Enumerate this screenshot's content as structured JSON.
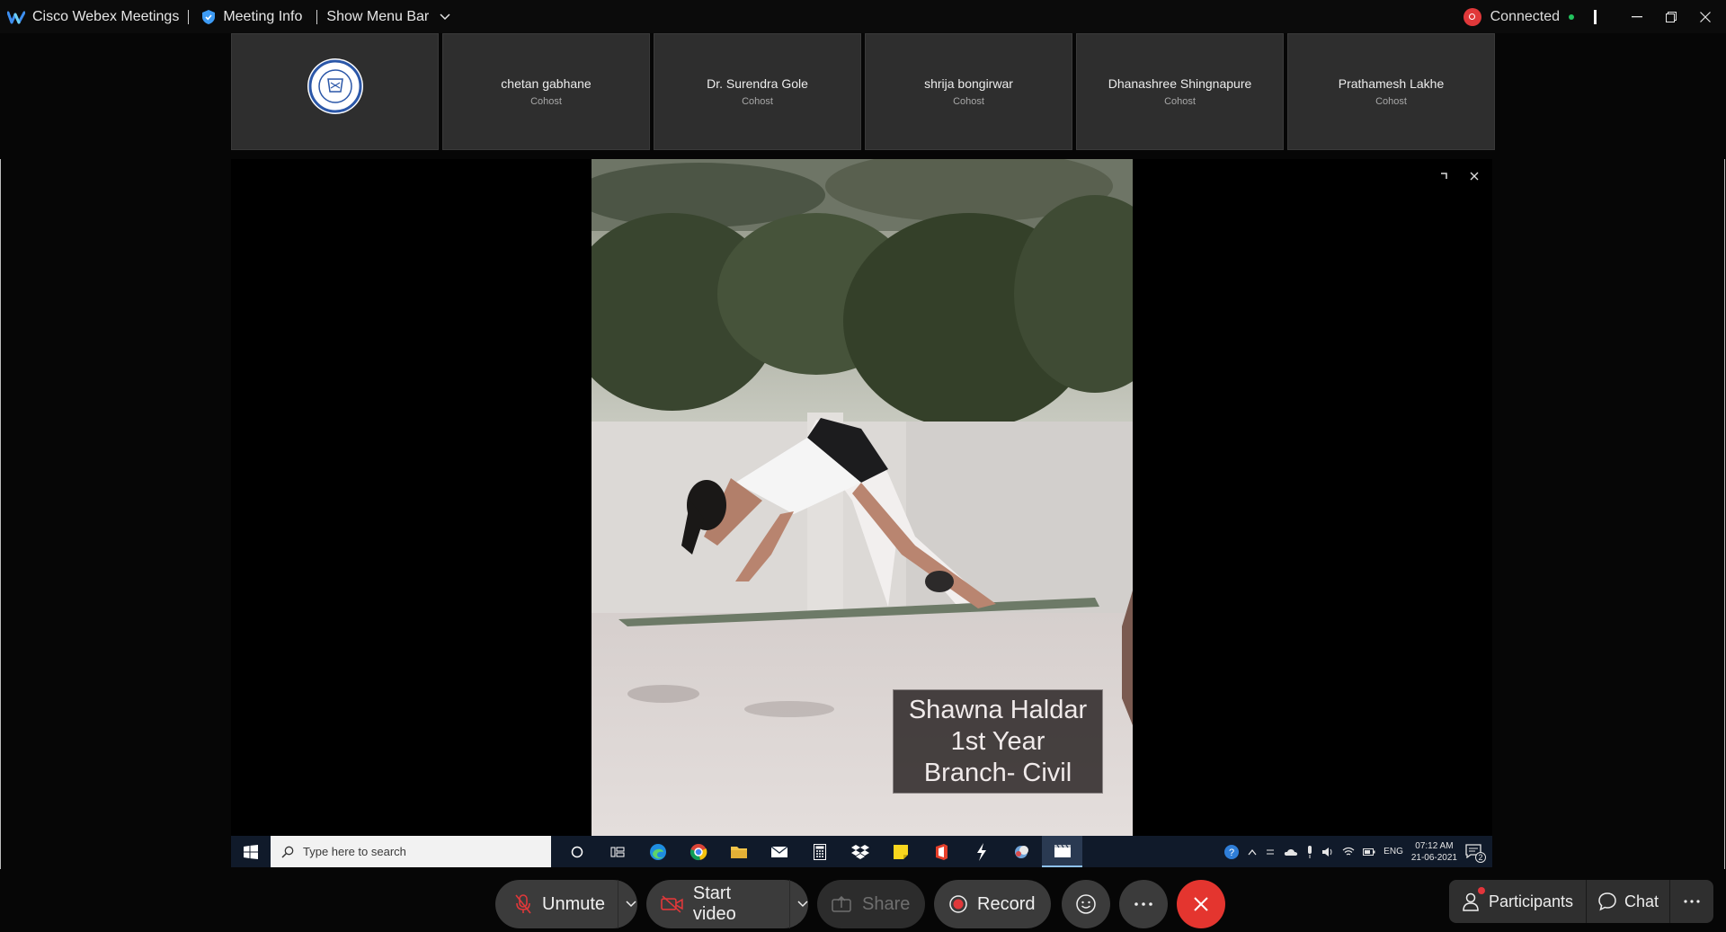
{
  "titlebar": {
    "app_name": "Cisco Webex Meetings",
    "meeting_info": "Meeting Info",
    "show_menu_bar": "Show Menu Bar",
    "status": "Connected"
  },
  "filmstrip": [
    {
      "name": "",
      "role": "",
      "type": "logo"
    },
    {
      "name": "chetan gabhane",
      "role": "Cohost"
    },
    {
      "name": "Dr. Surendra Gole",
      "role": "Cohost"
    },
    {
      "name": "shrija bongirwar",
      "role": "Cohost"
    },
    {
      "name": "Dhanashree Shingnapure",
      "role": "Cohost"
    },
    {
      "name": "Prathamesh Lakhe",
      "role": "Cohost"
    }
  ],
  "shared_video": {
    "caption_line1": "Shawna Haldar",
    "caption_line2": "1st Year",
    "caption_line3": "Branch- Civil"
  },
  "shared_taskbar": {
    "search_placeholder": "Type here to search",
    "language": "ENG",
    "time": "07:12 AM",
    "date": "21-06-2021",
    "notification_count": "2"
  },
  "controls": {
    "unmute": "Unmute",
    "start_video": "Start video",
    "share": "Share",
    "record": "Record",
    "participants": "Participants",
    "chat": "Chat"
  },
  "colors": {
    "end_button": "#e4352f",
    "record_dot": "#e0383a",
    "connected_dot": "#22c35e"
  }
}
